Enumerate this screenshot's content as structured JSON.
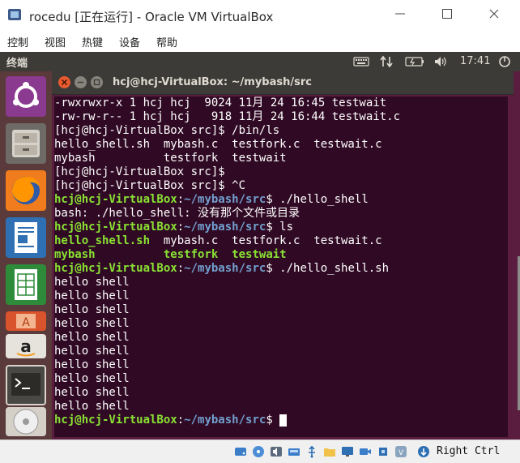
{
  "vbox": {
    "title": "rocedu [正在运行] - Oracle VM VirtualBox",
    "menu": [
      "控制",
      "视图",
      "热键",
      "设备",
      "帮助"
    ],
    "host_key": "Right Ctrl"
  },
  "ubuntu_panel": {
    "title": "终端",
    "clock": "17:41"
  },
  "terminal": {
    "title": "hcj@hcj-VirtualBox: ~/mybash/src",
    "prompt_user": "hcj@hcj-VirtualBox",
    "prompt_path": "~/mybash/src",
    "lines": {
      "l1": "-rwxrwxr-x 1 hcj hcj  9024 11月 24 16:45 testwait",
      "l2": "-rw-rw-r-- 1 hcj hcj   918 11月 24 16:44 testwait.c",
      "l3": "[hcj@hcj-VirtualBox src]$ /bin/ls",
      "l4": "hello_shell.sh  mybash.c  testfork.c  testwait.c",
      "l5": "mybash          testfork  testwait",
      "l6": "[hcj@hcj-VirtualBox src]$",
      "l7": "[hcj@hcj-VirtualBox src]$ ^C",
      "l8_cmd": "$ ./hello_shell",
      "l9": "bash: ./hello_shell: 没有那个文件或目录",
      "l10_cmd": "$ ls",
      "l11_a": "hello_shell.sh",
      "l11_b": "  mybash.c  testfork.c  testwait.c",
      "l12_a": "mybash",
      "l12_b": "          ",
      "l12_c": "testfork",
      "l12_d": "  ",
      "l12_e": "testwait",
      "l13_cmd": "$ ./hello_shell.sh",
      "hello": "hello shell",
      "last_cmd": "$ "
    }
  },
  "colors": {
    "terminal_bg": "#300a24",
    "prompt_green": "#8ae234",
    "path_blue": "#729fcf",
    "desktop_bg": "#5b1d3f",
    "panel_bg": "#3c3b37"
  },
  "icons": {
    "launcher": [
      "ubuntu-dash-icon",
      "files-icon",
      "firefox-icon",
      "writer-icon",
      "calc-icon",
      "software-center-icon",
      "amazon-icon",
      "terminal-icon",
      "dvd-icon"
    ],
    "indicators": [
      "keyboard-icon",
      "network-icon",
      "battery-icon",
      "volume-icon",
      "settings-icon"
    ]
  }
}
